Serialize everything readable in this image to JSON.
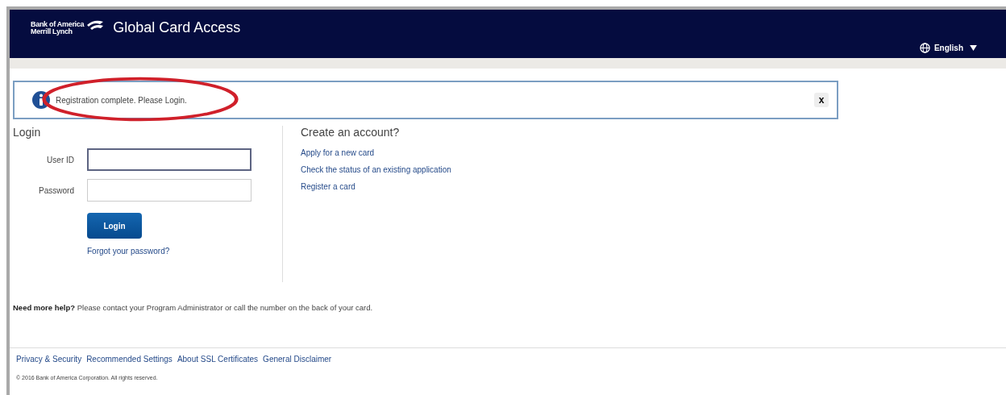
{
  "header": {
    "logo_lines": [
      "Bank of America",
      "Merrill Lynch"
    ],
    "title": "Global Card Access",
    "language": "English"
  },
  "alert": {
    "message": "Registration complete. Please Login.",
    "close": "x",
    "highlighted": true
  },
  "login": {
    "heading": "Login",
    "fields": [
      {
        "label": "User ID",
        "focused": true
      },
      {
        "label": "Password",
        "focused": false
      }
    ],
    "button": "Login",
    "forgot": "Forgot your password?"
  },
  "create": {
    "heading": "Create an account?",
    "links": [
      "Apply for a new card",
      "Check the status of an existing application",
      "Register a card"
    ]
  },
  "help": {
    "lead": "Need more help?",
    "text": "Please contact your Program Administrator or call the number on the back of your card."
  },
  "footer": {
    "links": [
      "Privacy & Security",
      "Recommended Settings",
      "About SSL Certificates",
      "General Disclaimer"
    ],
    "copyright": "© 2016 Bank of America Corporation. All rights reserved."
  }
}
